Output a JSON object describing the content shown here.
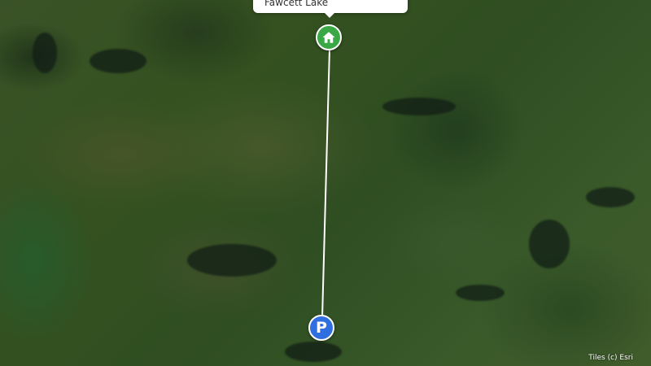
{
  "map": {
    "popup": {
      "label": "Fawcett Lake"
    },
    "markers": [
      {
        "type": "home",
        "icon": "home-icon",
        "color": "#3aa845"
      },
      {
        "type": "parking",
        "icon": "parking-icon",
        "label": "P",
        "color": "#2f6fe0"
      }
    ],
    "route": {
      "color": "#ffffff"
    },
    "attribution": "Tiles (c) Esri"
  }
}
